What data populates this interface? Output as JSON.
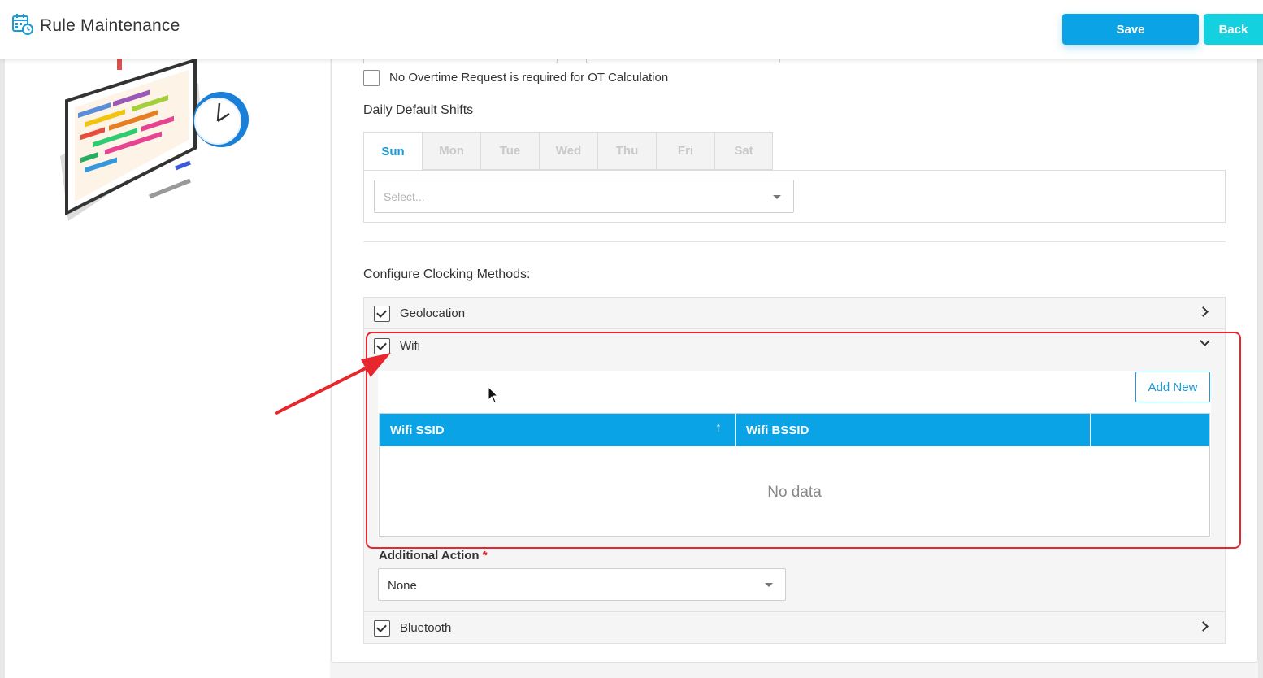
{
  "header": {
    "title": "Rule Maintenance",
    "save_label": "Save",
    "back_label": "Back",
    "logo_icon": "calendar-clock-icon"
  },
  "overtime": {
    "label": "No Overtime Request is required for OT Calculation",
    "checked": false
  },
  "daily_shifts": {
    "title": "Daily Default Shifts",
    "tabs": [
      "Sun",
      "Mon",
      "Tue",
      "Wed",
      "Thu",
      "Fri",
      "Sat"
    ],
    "active_tab": "Sun",
    "select_placeholder": "Select..."
  },
  "clocking": {
    "title": "Configure Clocking Methods:",
    "methods": [
      {
        "name": "Geolocation",
        "checked": true,
        "expanded": false
      },
      {
        "name": "Wifi",
        "checked": true,
        "expanded": true
      },
      {
        "name": "Bluetooth",
        "checked": true,
        "expanded": false
      }
    ],
    "wifi": {
      "add_new_label": "Add New",
      "columns": [
        "Wifi SSID",
        "Wifi BSSID",
        ""
      ],
      "sort_indicator": "↑",
      "no_data": "No data",
      "additional_action_label": "Additional Action",
      "required_mark": "*",
      "additional_action_value": "None"
    }
  },
  "colors": {
    "primary": "#0aa3e6",
    "secondary": "#14d1e0",
    "annotation": "#e8262d"
  }
}
